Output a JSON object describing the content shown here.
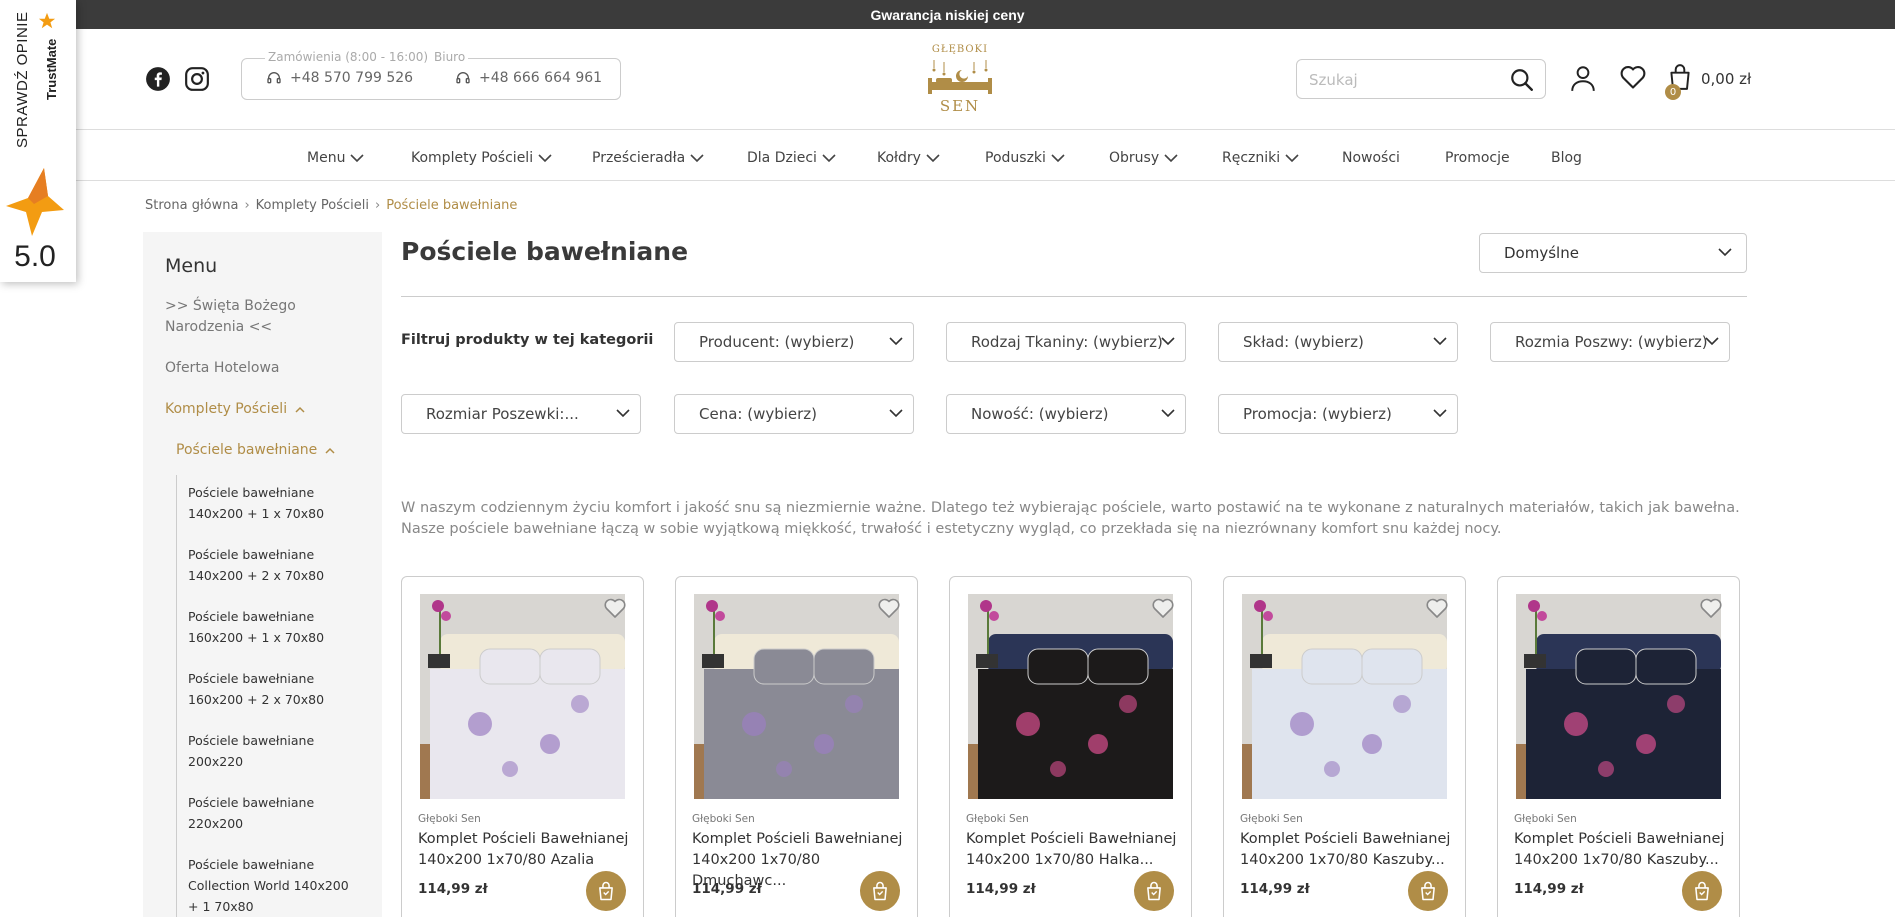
{
  "topbar": {
    "text": "Gwarancja niskiej ceny"
  },
  "trustmate": {
    "label": "SPRAWDŹ OPINIE",
    "brand": "TrustMate",
    "score": "5.0"
  },
  "header": {
    "orders_legend": "Zamówienia (8:00 - 16:00)",
    "office_legend": "Biuro",
    "orders_phone": "+48 570 799 526",
    "office_phone": "+48 666 664 961",
    "logo_top": "GŁĘBOKI",
    "logo_bottom": "SEN",
    "search_placeholder": "Szukaj",
    "cart_count": "0",
    "cart_total": "0,00 zł"
  },
  "nav": [
    {
      "label": "Menu",
      "dropdown": true
    },
    {
      "label": "Komplety Pościeli",
      "dropdown": true
    },
    {
      "label": "Prześcieradła",
      "dropdown": true
    },
    {
      "label": "Dla Dzieci",
      "dropdown": true
    },
    {
      "label": "Kołdry",
      "dropdown": true
    },
    {
      "label": "Poduszki",
      "dropdown": true
    },
    {
      "label": "Obrusy",
      "dropdown": true
    },
    {
      "label": "Ręczniki",
      "dropdown": true
    },
    {
      "label": "Nowości",
      "dropdown": false
    },
    {
      "label": "Promocje",
      "dropdown": false
    },
    {
      "label": "Blog",
      "dropdown": false
    }
  ],
  "breadcrumb": {
    "home": "Strona główna",
    "category": "Komplety Pościeli",
    "current": "Pościele bawełniane"
  },
  "sidebar": {
    "title": "Menu",
    "links": [
      ">> Święta Bożego Narodzenia <<",
      "Oferta Hotelowa",
      "Komplety Pościeli",
      "Pościele bawełniane"
    ],
    "subitems": [
      "Pościele bawełniane 140x200 + 1 x 70x80",
      "Pościele bawełniane 140x200 + 2 x 70x80",
      "Pościele bawełniane 160x200 + 1 x 70x80",
      "Pościele bawełniane 160x200 + 2 x 70x80",
      "Pościele bawełniane 200x220",
      "Pościele bawełniane 220x200",
      "Pościele bawełniane Collection World 140x200 + 1 70x80"
    ]
  },
  "main": {
    "title": "Pościele bawełniane",
    "sort_selected": "Domyślne",
    "filter_label": "Filtruj produkty w tej kategorii",
    "filters": [
      "Producent: (wybierz)",
      "Rodzaj Tkaniny: (wybierz)",
      "Skład: (wybierz)",
      "Rozmia Poszwy: (wybierz)",
      "Rozmiar Poszewki:...",
      "Cena: (wybierz)",
      "Nowość: (wybierz)",
      "Promocja: (wybierz)"
    ],
    "description": "W naszym codziennym życiu komfort i jakość snu są niezmiernie ważne. Dlatego też wybierając pościele, warto postawić na te wykonane z naturalnych materiałów, takich jak bawełna. Nasze pościele bawełniane łączą w sobie wyjątkową miękkość, trwałość i estetyczny wygląd, co przekłada się na niezrównany komfort snu każdej nocy."
  },
  "products": [
    {
      "brand": "Głęboki Sen",
      "name": "Komplet Pościeli Bawełnianej 140x200 1x70/80 Azalia",
      "price": "114,99 zł",
      "palette": "#e9e7ee"
    },
    {
      "brand": "Głęboki Sen",
      "name": "Komplet Pościeli Bawełnianej 140x200 1x70/80 Dmuchawc...",
      "price": "114,99 zł",
      "palette": "#8a8a95"
    },
    {
      "brand": "Głęboki Sen",
      "name": "Komplet Pościeli Bawełnianej 140x200 1x70/80 Halka...",
      "price": "114,99 zł",
      "palette": "#1c1a1a"
    },
    {
      "brand": "Głęboki Sen",
      "name": "Komplet Pościeli Bawełnianej 140x200 1x70/80 Kaszuby...",
      "price": "114,99 zł",
      "palette": "#dfe4ee"
    },
    {
      "brand": "Głęboki Sen",
      "name": "Komplet Pościeli Bawełnianej 140x200 1x70/80 Kaszuby...",
      "price": "114,99 zł",
      "palette": "#1d2336"
    }
  ],
  "colors": {
    "gold": "#b08d47",
    "topbar": "#3b3b3b"
  }
}
